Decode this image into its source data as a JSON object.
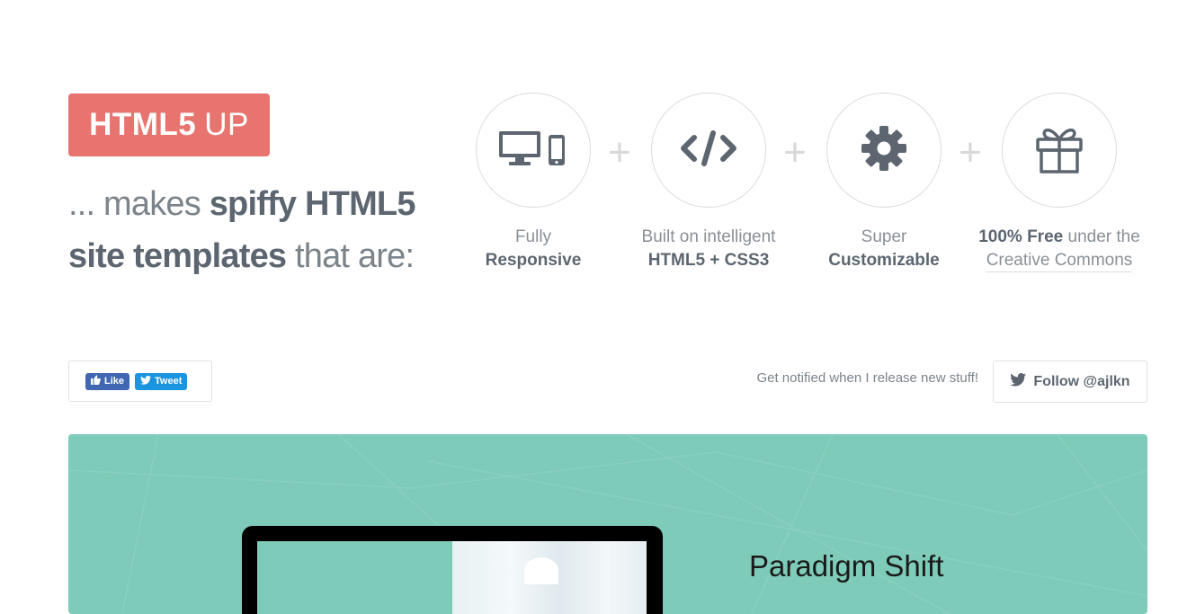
{
  "logo": {
    "bold": "HTML5",
    "light": "UP"
  },
  "tagline": {
    "part1": "... makes ",
    "bold1": "spiffy HTML5",
    "bold2": "site templates",
    "part2": " that are:"
  },
  "features": [
    {
      "icon": "responsive-devices-icon",
      "line1": "Fully",
      "line2": "Responsive"
    },
    {
      "icon": "code-icon",
      "line1": "Built on intelligent",
      "line2": "HTML5 + CSS3"
    },
    {
      "icon": "gear-icon",
      "line1": "Super",
      "line2": "Customizable"
    },
    {
      "icon": "gift-icon",
      "line1_bold": "100% Free",
      "line1_rest": " under the",
      "line2": "Creative Commons"
    }
  ],
  "social": {
    "like_label": "Like",
    "tweet_label": "Tweet"
  },
  "notify": {
    "text": "Get notified when I release new stuff!",
    "follow_label": "Follow @ajlkn"
  },
  "banner": {
    "title": "Paradigm Shift"
  },
  "colors": {
    "accent": "#e7746f",
    "banner": "#7ecbb9",
    "text": "#5d6670",
    "facebook": "#4267b2",
    "twitter": "#1b95e0"
  }
}
